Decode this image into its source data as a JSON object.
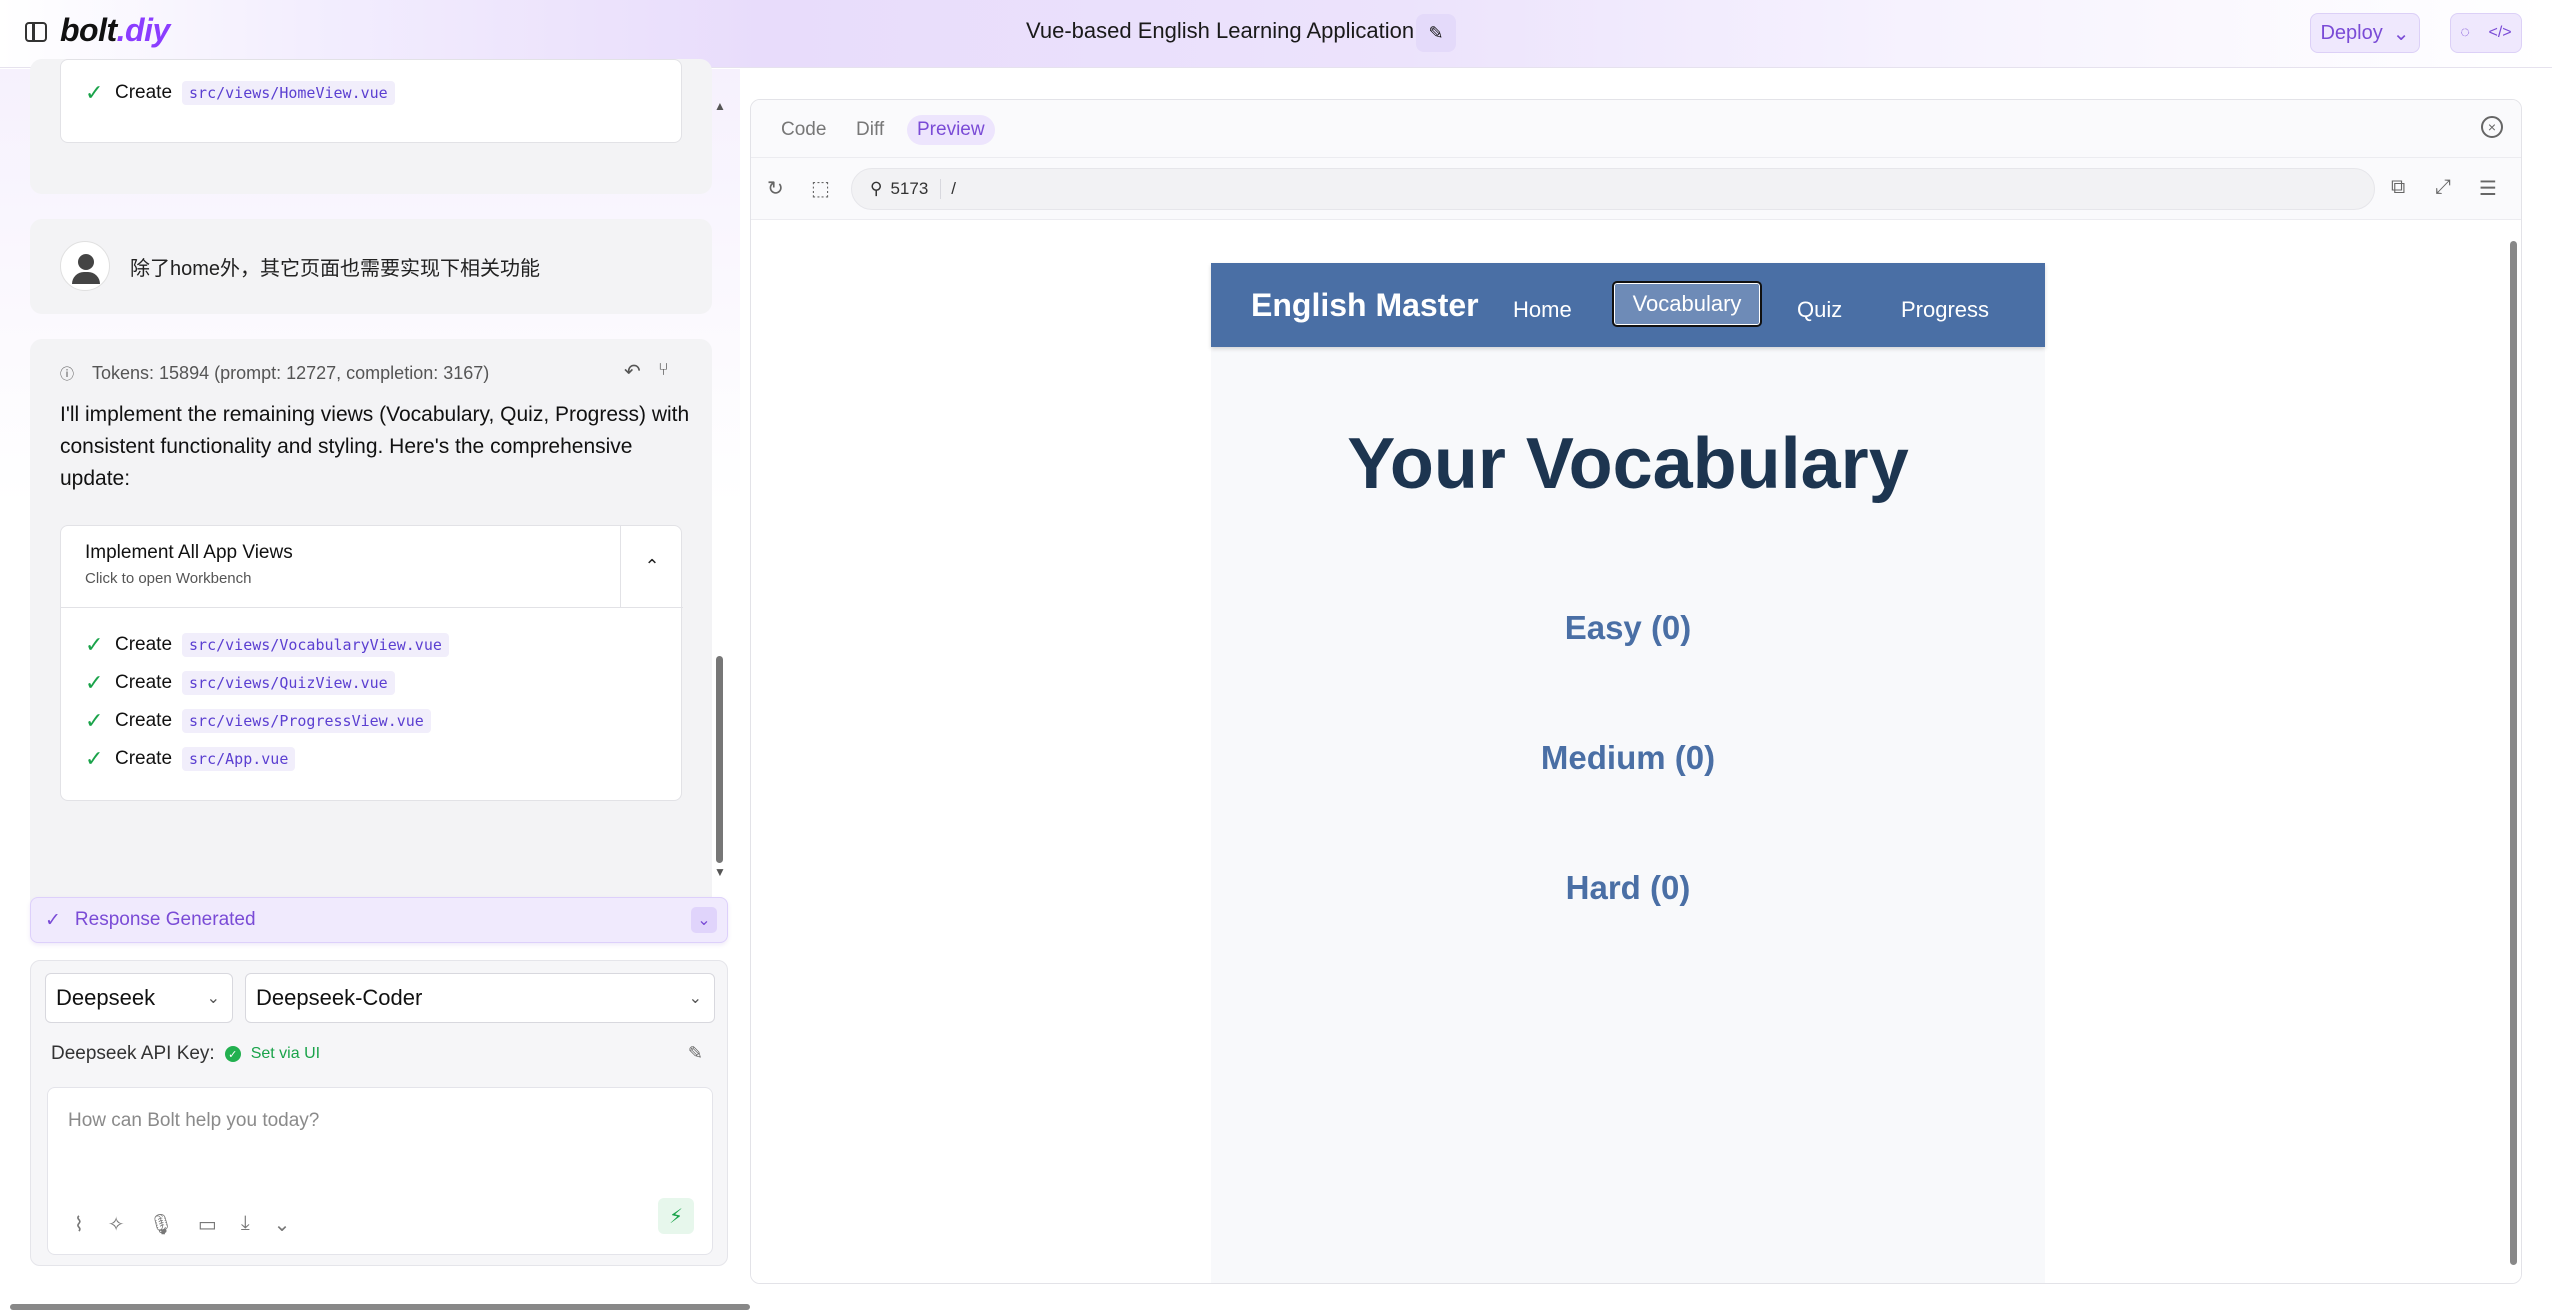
{
  "header": {
    "logo": "bolt",
    "logo_suffix": ".diy",
    "project_title": "Vue-based English Learning Application",
    "deploy_label": "Deploy"
  },
  "chat": {
    "prev_action": {
      "verb": "Create",
      "file": "src/views/HomeView.vue"
    },
    "user_message": "除了home外，其它页面也需要实现下相关功能",
    "tokens": "Tokens: 15894 (prompt: 12727, completion: 3167)",
    "assistant_message": "I'll implement the remaining views (Vocabulary, Quiz, Progress) with consistent functionality and styling. Here's the comprehensive update:",
    "artifact": {
      "title": "Implement All App Views",
      "subtitle": "Click to open Workbench",
      "actions": [
        {
          "verb": "Create",
          "file": "src/views/VocabularyView.vue"
        },
        {
          "verb": "Create",
          "file": "src/views/QuizView.vue"
        },
        {
          "verb": "Create",
          "file": "src/views/ProgressView.vue"
        },
        {
          "verb": "Create",
          "file": "src/App.vue"
        }
      ]
    },
    "response_status": "Response Generated"
  },
  "input": {
    "provider": "Deepseek",
    "model": "Deepseek-Coder",
    "api_key_label": "Deepseek API Key:",
    "api_key_status": "Set via UI",
    "placeholder": "How can Bolt help you today?"
  },
  "workbench": {
    "tabs": [
      "Code",
      "Diff",
      "Preview"
    ],
    "active_tab": "Preview",
    "port": "5173",
    "path": "/"
  },
  "preview_app": {
    "brand": "English Master",
    "nav": [
      "Home",
      "Vocabulary",
      "Quiz",
      "Progress"
    ],
    "active_nav": "Vocabulary",
    "heading": "Your Vocabulary",
    "levels": [
      "Easy (0)",
      "Medium (0)",
      "Hard (0)"
    ]
  },
  "colors": {
    "accent": "#7a4bd6",
    "app_nav": "#4a6fa5",
    "success": "#1aa34a"
  }
}
